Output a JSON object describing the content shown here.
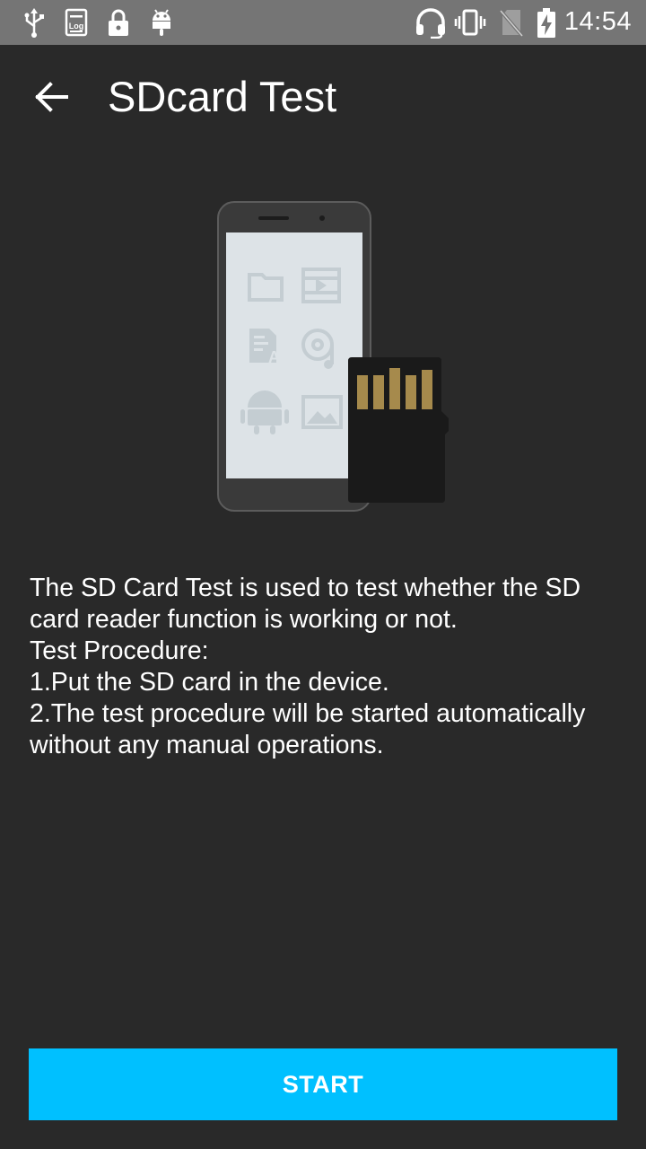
{
  "status_bar": {
    "time": "14:54",
    "left_icons": [
      "usb-icon",
      "log-icon",
      "lock-icon",
      "android-debug-icon"
    ],
    "right_icons": [
      "headset-icon",
      "vibrate-icon",
      "no-sim-icon",
      "battery-charging-icon"
    ]
  },
  "app_bar": {
    "back_icon": "arrow-back-icon",
    "title": "SDcard Test"
  },
  "illustration": {
    "name": "phone-with-sd-card",
    "icons": [
      "folder-icon",
      "video-icon",
      "document-icon",
      "music-icon",
      "android-icon",
      "image-icon"
    ],
    "colors": {
      "card": "#1a1a1a",
      "contacts": "#a68a4c",
      "screen": "#dde3e7"
    }
  },
  "description": {
    "lines": [
      "The SD Card Test is used to test whether the SD",
      "card reader function is working or not.",
      "Test Procedure:",
      "1.Put the SD card in the device.",
      "2.The test procedure will be started automatically",
      "without any manual operations."
    ]
  },
  "actions": {
    "start_label": "START",
    "accent_color": "#00c0ff"
  }
}
